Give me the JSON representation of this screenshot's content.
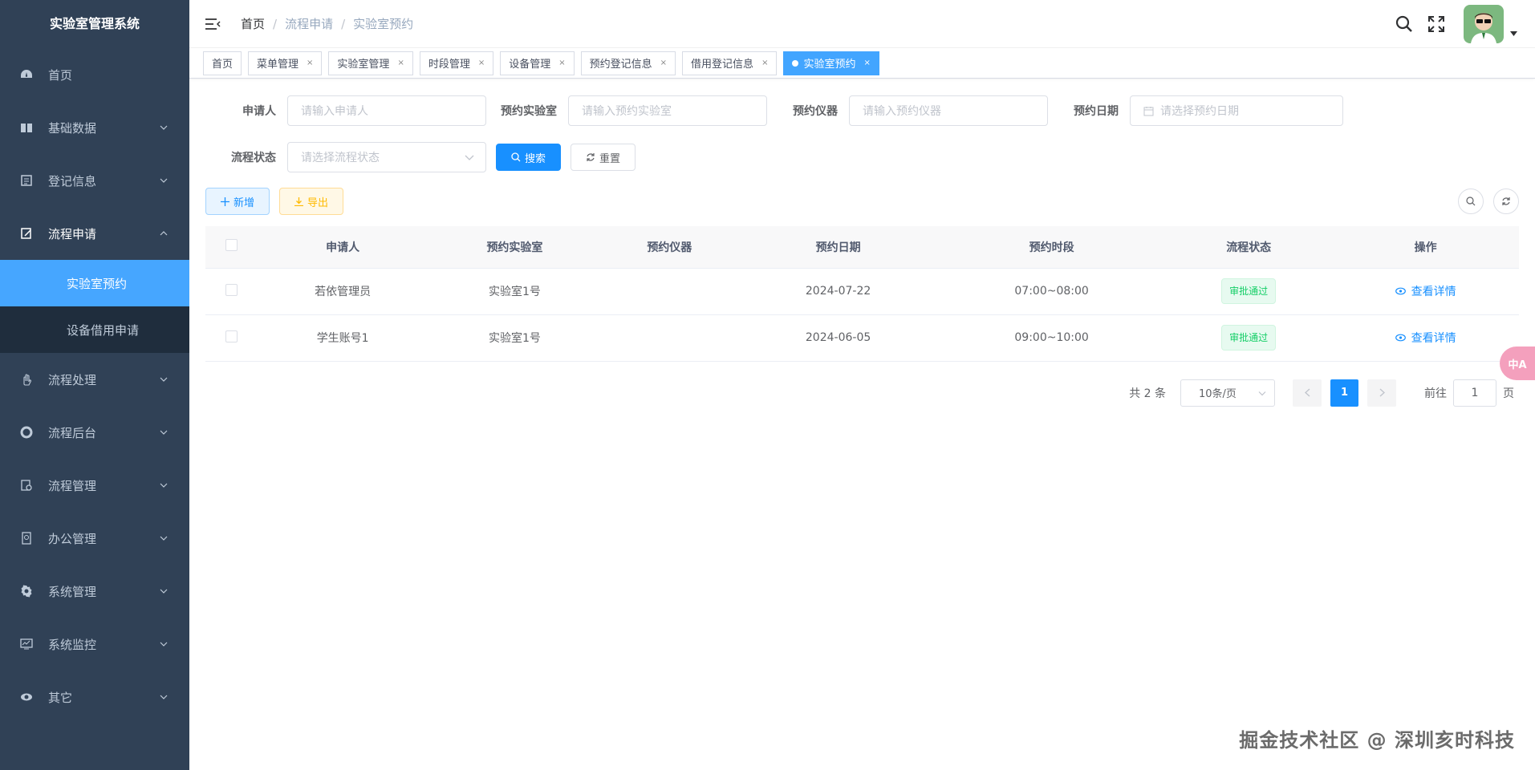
{
  "app": {
    "title": "实验室管理系统"
  },
  "sidebar": {
    "items": [
      {
        "label": "首页",
        "icon": "dashboard-icon"
      },
      {
        "label": "基础数据",
        "icon": "book-icon"
      },
      {
        "label": "登记信息",
        "icon": "record-icon"
      },
      {
        "label": "流程申请",
        "icon": "edit-icon",
        "expanded": true,
        "children": [
          {
            "label": "实验室预约",
            "active": true
          },
          {
            "label": "设备借用申请"
          }
        ]
      },
      {
        "label": "流程处理",
        "icon": "hand-icon"
      },
      {
        "label": "流程后台",
        "icon": "lifebuoy-icon"
      },
      {
        "label": "流程管理",
        "icon": "doc-gear-icon"
      },
      {
        "label": "办公管理",
        "icon": "office-icon"
      },
      {
        "label": "系统管理",
        "icon": "gear-icon"
      },
      {
        "label": "系统监控",
        "icon": "monitor-icon"
      },
      {
        "label": "其它",
        "icon": "eye-icon"
      }
    ]
  },
  "header": {
    "breadcrumb": [
      "首页",
      "流程申请",
      "实验室预约"
    ],
    "breadcrumb_sep": "/"
  },
  "tags": [
    {
      "label": "首页",
      "closable": false
    },
    {
      "label": "菜单管理",
      "closable": true
    },
    {
      "label": "实验室管理",
      "closable": true
    },
    {
      "label": "时段管理",
      "closable": true
    },
    {
      "label": "设备管理",
      "closable": true
    },
    {
      "label": "预约登记信息",
      "closable": true
    },
    {
      "label": "借用登记信息",
      "closable": true
    },
    {
      "label": "实验室预约",
      "closable": true,
      "active": true
    }
  ],
  "tag_close_glyph": "×",
  "search": {
    "applicant_label": "申请人",
    "applicant_placeholder": "请输入申请人",
    "lab_label": "预约实验室",
    "lab_placeholder": "请输入预约实验室",
    "instrument_label": "预约仪器",
    "instrument_placeholder": "请输入预约仪器",
    "date_label": "预约日期",
    "date_placeholder": "请选择预约日期",
    "status_label": "流程状态",
    "status_placeholder": "请选择流程状态",
    "search_button": "搜索",
    "reset_button": "重置"
  },
  "toolbar": {
    "add_button": "新增",
    "export_button": "导出"
  },
  "table": {
    "columns": [
      "申请人",
      "预约实验室",
      "预约仪器",
      "预约日期",
      "预约时段",
      "流程状态",
      "操作"
    ],
    "rows": [
      {
        "applicant": "若依管理员",
        "lab": "实验室1号",
        "instrument": "",
        "date": "2024-07-22",
        "slot": "07:00~08:00",
        "status": "审批通过",
        "action": "查看详情"
      },
      {
        "applicant": "学生账号1",
        "lab": "实验室1号",
        "instrument": "",
        "date": "2024-06-05",
        "slot": "09:00~10:00",
        "status": "审批通过",
        "action": "查看详情"
      }
    ]
  },
  "pagination": {
    "total_text": "共 2 条",
    "page_size": "10条/页",
    "current_page": "1",
    "goto_prefix": "前往",
    "goto_value": "1",
    "goto_suffix": "页"
  },
  "float_button": {
    "label": "中A"
  },
  "watermark": "掘金技术社区 @ 深圳亥时科技",
  "colors": {
    "sidebar_bg": "#304156",
    "active_menu": "#46a6ff",
    "primary": "#1890ff",
    "success": "#13ce66",
    "warning": "#ffba00"
  }
}
